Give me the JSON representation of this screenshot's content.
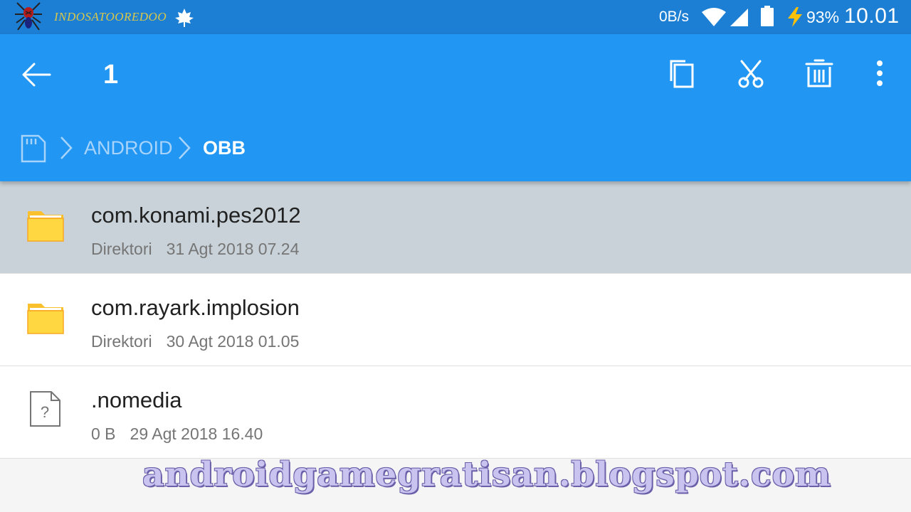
{
  "status_bar": {
    "carrier": "INDOSATOOREDOO",
    "net_speed": "0B/s",
    "battery_percent": "93%",
    "time": "10.01",
    "icons": [
      "spider-logo-icon",
      "maple-leaf-icon",
      "wifi-icon",
      "signal-icon",
      "battery-icon",
      "charging-bolt-icon"
    ]
  },
  "app_bar": {
    "selection_count": "1",
    "actions": [
      "back-arrow-icon",
      "copy-icon",
      "cut-icon",
      "delete-icon",
      "more-vert-icon"
    ]
  },
  "breadcrumb": {
    "root_icon": "sd-card-icon",
    "items": [
      "ANDROID",
      "OBB"
    ]
  },
  "files": [
    {
      "name": "com.konami.pes2012",
      "type": "Direktori",
      "date": "31 Agt 2018 07.24",
      "icon": "folder-icon",
      "selected": true
    },
    {
      "name": "com.rayark.implosion",
      "type": "Direktori",
      "date": "30 Agt 2018 01.05",
      "icon": "folder-icon",
      "selected": false
    },
    {
      "name": ".nomedia",
      "type": "0 B",
      "date": "29 Agt 2018 16.40",
      "icon": "unknown-file-icon",
      "selected": false
    }
  ],
  "watermark": "androidgamegratisan.blogspot.com",
  "colors": {
    "status_bar": "#1c7fd4",
    "app_bar": "#2196f3",
    "selected_row": "#c8d2d8",
    "folder": "#fdd835"
  }
}
